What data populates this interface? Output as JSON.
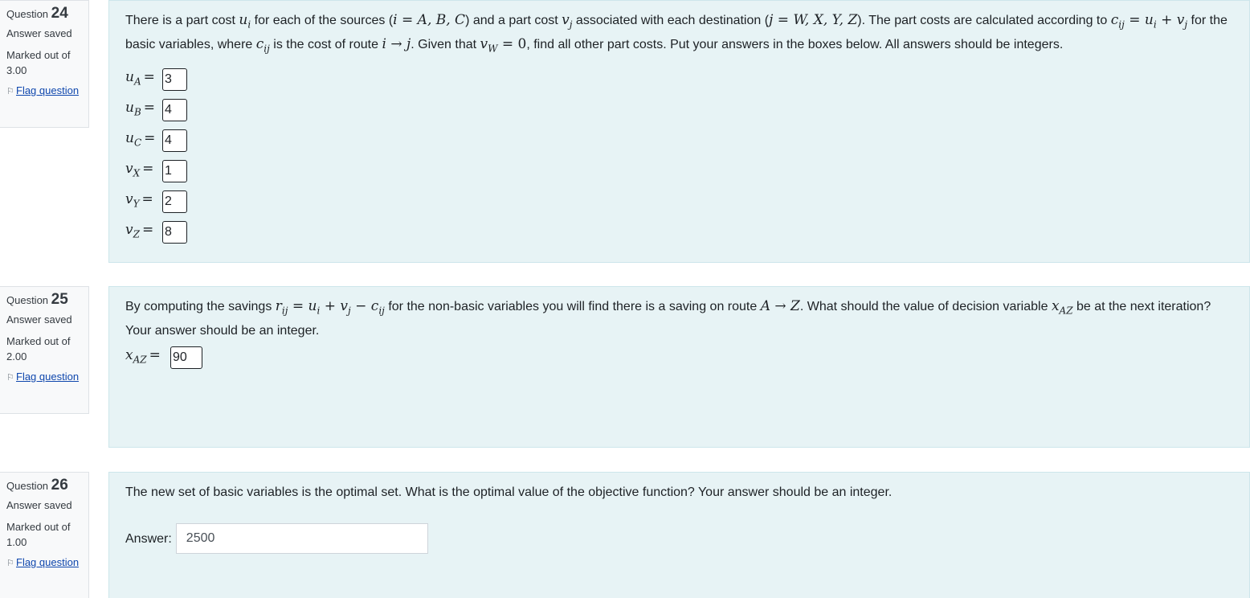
{
  "questions": [
    {
      "label": "Question",
      "number": "24",
      "state": "Answer saved",
      "grade": "Marked out of 3.00",
      "flag": "Flag question",
      "text": {
        "p1": "There is a part cost ",
        "p2": " for each of the sources (",
        "p3": ") and a part cost ",
        "p4": " associated with each destination (",
        "p5": "). The part costs are calculated according to ",
        "p6": " for the basic variables, where ",
        "p7": " is the cost of route ",
        "p8": ". Given that ",
        "p9": ", find all other part costs. Put your answers in the boxes below. All answers should be integers."
      },
      "answers": [
        {
          "var": "u",
          "sub": "A",
          "value": "3"
        },
        {
          "var": "u",
          "sub": "B",
          "value": "4"
        },
        {
          "var": "u",
          "sub": "C",
          "value": "4"
        },
        {
          "var": "v",
          "sub": "X",
          "value": "1"
        },
        {
          "var": "v",
          "sub": "Y",
          "value": "2"
        },
        {
          "var": "v",
          "sub": "Z",
          "value": "8"
        }
      ]
    },
    {
      "label": "Question",
      "number": "25",
      "state": "Answer saved",
      "grade": "Marked out of 2.00",
      "flag": "Flag question",
      "text": {
        "p1": "By computing the savings ",
        "p2": " for the non-basic variables you will find there is a saving on route ",
        "p3": ". What should the value of decision variable ",
        "p4": " be at the next iteration? Your answer should be an integer."
      },
      "answer": {
        "var": "x",
        "sub": "AZ",
        "value": "90"
      }
    },
    {
      "label": "Question",
      "number": "26",
      "state": "Answer saved",
      "grade": "Marked out of 1.00",
      "flag": "Flag question",
      "text": "The new set of basic variables is the optimal set. What is the optimal value of the objective function? Your answer should be an integer.",
      "answer_label": "Answer:",
      "answer_value": "2500"
    }
  ],
  "colors": {
    "content_bg": "#e7f3f5",
    "info_bg": "#f8f9fa",
    "link": "#0f47ad"
  }
}
